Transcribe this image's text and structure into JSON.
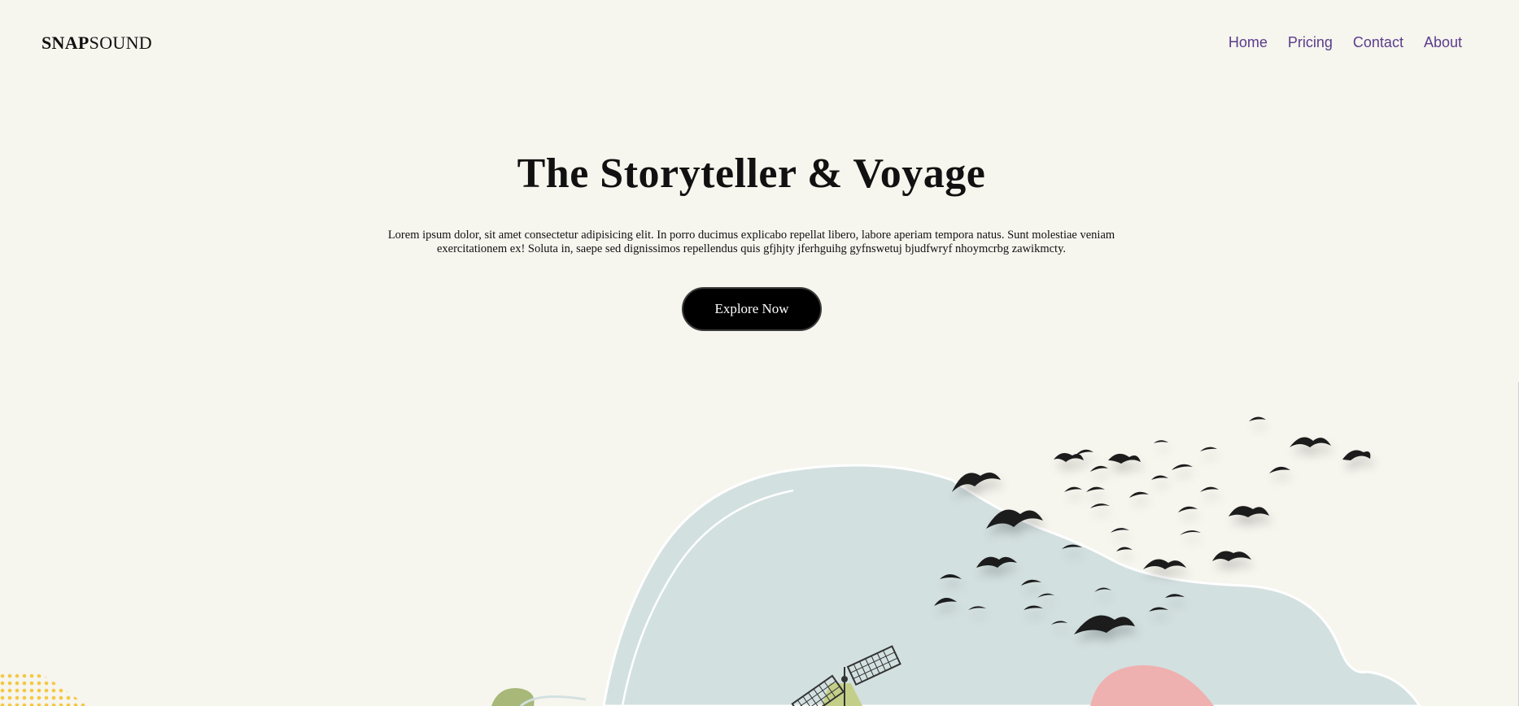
{
  "brand": {
    "logo_bold": "SNAP",
    "logo_regular": "SOUND"
  },
  "nav": {
    "items": [
      {
        "label": "Home"
      },
      {
        "label": "Pricing"
      },
      {
        "label": "Contact"
      },
      {
        "label": "About"
      }
    ],
    "link_color": "#5a3c8c"
  },
  "hero": {
    "title": "The Storyteller & Voyage",
    "description": "Lorem ipsum dolor, sit amet consectetur adipisicing elit. In porro ducimus explicabo repellat libero, labore aperiam tempora natus. Sunt molestiae veniam exercitationem ex! Soluta in, saepe sed dignissimos repellendus quis gfjhjty jferhguihg gyfnswetuj bjudfwryf nhoymcrbg zawikmcty.",
    "cta_label": "Explore Now"
  },
  "colors": {
    "background": "#f6f5ee",
    "cloud": "#d3e0e0",
    "bird": "#1c1c1c",
    "pink_blob": "#eeb1b0",
    "green_blob": "#a7b879",
    "dots": "#f5c842"
  }
}
